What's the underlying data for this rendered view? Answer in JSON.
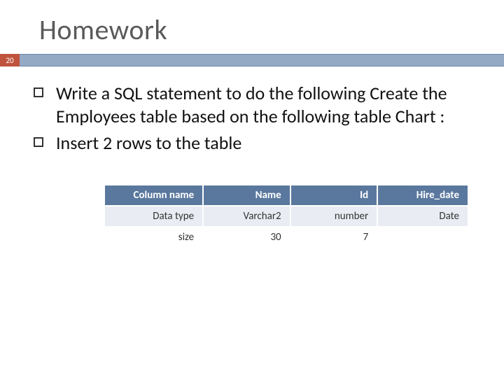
{
  "title": "Homework",
  "slide_number": "20",
  "bullets": [
    "Write a SQL statement to do the following Create the Employees  table based on the following table Chart :",
    "Insert 2 rows to the table"
  ],
  "chart_data": {
    "type": "table",
    "columns": [
      "Column name",
      "Name",
      "Id",
      "Hire_date"
    ],
    "rows": [
      [
        "Data type",
        "Varchar2",
        "number",
        "Date"
      ],
      [
        "size",
        "30",
        "7",
        ""
      ]
    ]
  }
}
